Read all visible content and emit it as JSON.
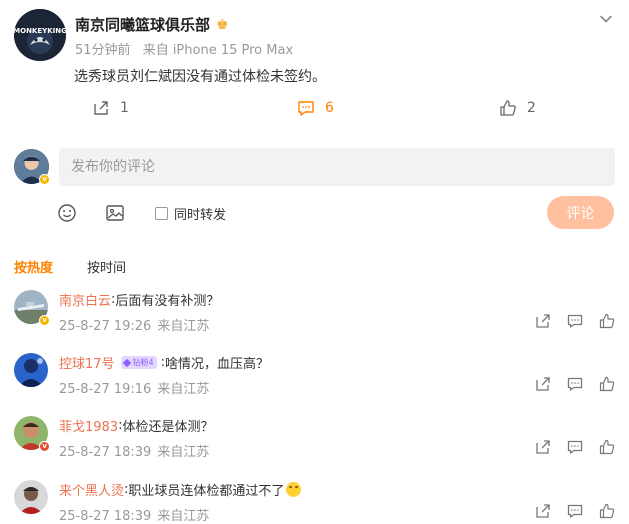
{
  "post": {
    "author": "南京同曦篮球俱乐部",
    "time": "51分钟前",
    "source": "来自 iPhone 15 Pro Max",
    "text": "选秀球员刘仁斌因没有通过体检未签约。",
    "logo_text": "NANJING MONKEYKING",
    "actions": {
      "repost_count": "1",
      "comment_count": "6",
      "like_count": "2"
    }
  },
  "composer": {
    "placeholder": "发布你的评论",
    "repost_label": "同时转发",
    "submit_label": "评论"
  },
  "sort": {
    "hot_label": "按热度",
    "time_label": "按时间"
  },
  "comments": [
    {
      "user": "南京白云",
      "text": "后面有没有补测？",
      "date": "25-8-27 19:26",
      "location": "来自江苏"
    },
    {
      "user": "控球17号",
      "badge": "钻粉4",
      "text": "啥情况，血压高？",
      "date": "25-8-27 19:16",
      "location": "来自江苏"
    },
    {
      "user": "菲戈1983",
      "text": "体检还是体测？",
      "date": "25-8-27 18:39",
      "location": "来自江苏"
    },
    {
      "user": "来个黑人烫",
      "text": "职业球员连体检都通过不了",
      "date": "25-8-27 18:39",
      "location": "来自江苏"
    }
  ],
  "colors": {
    "accent": "#ff8200",
    "username": "#eb7350",
    "submit_disabled": "#ffc09f",
    "meta_gray": "#999999"
  },
  "icons": {
    "header": [
      "crown-icon",
      "chevron-down-icon"
    ],
    "actions": [
      "repost-icon",
      "comment-icon",
      "like-icon"
    ],
    "composer": [
      "emoji-icon",
      "image-icon"
    ],
    "comment_actions": [
      "share-icon",
      "comment-icon",
      "like-icon"
    ]
  }
}
